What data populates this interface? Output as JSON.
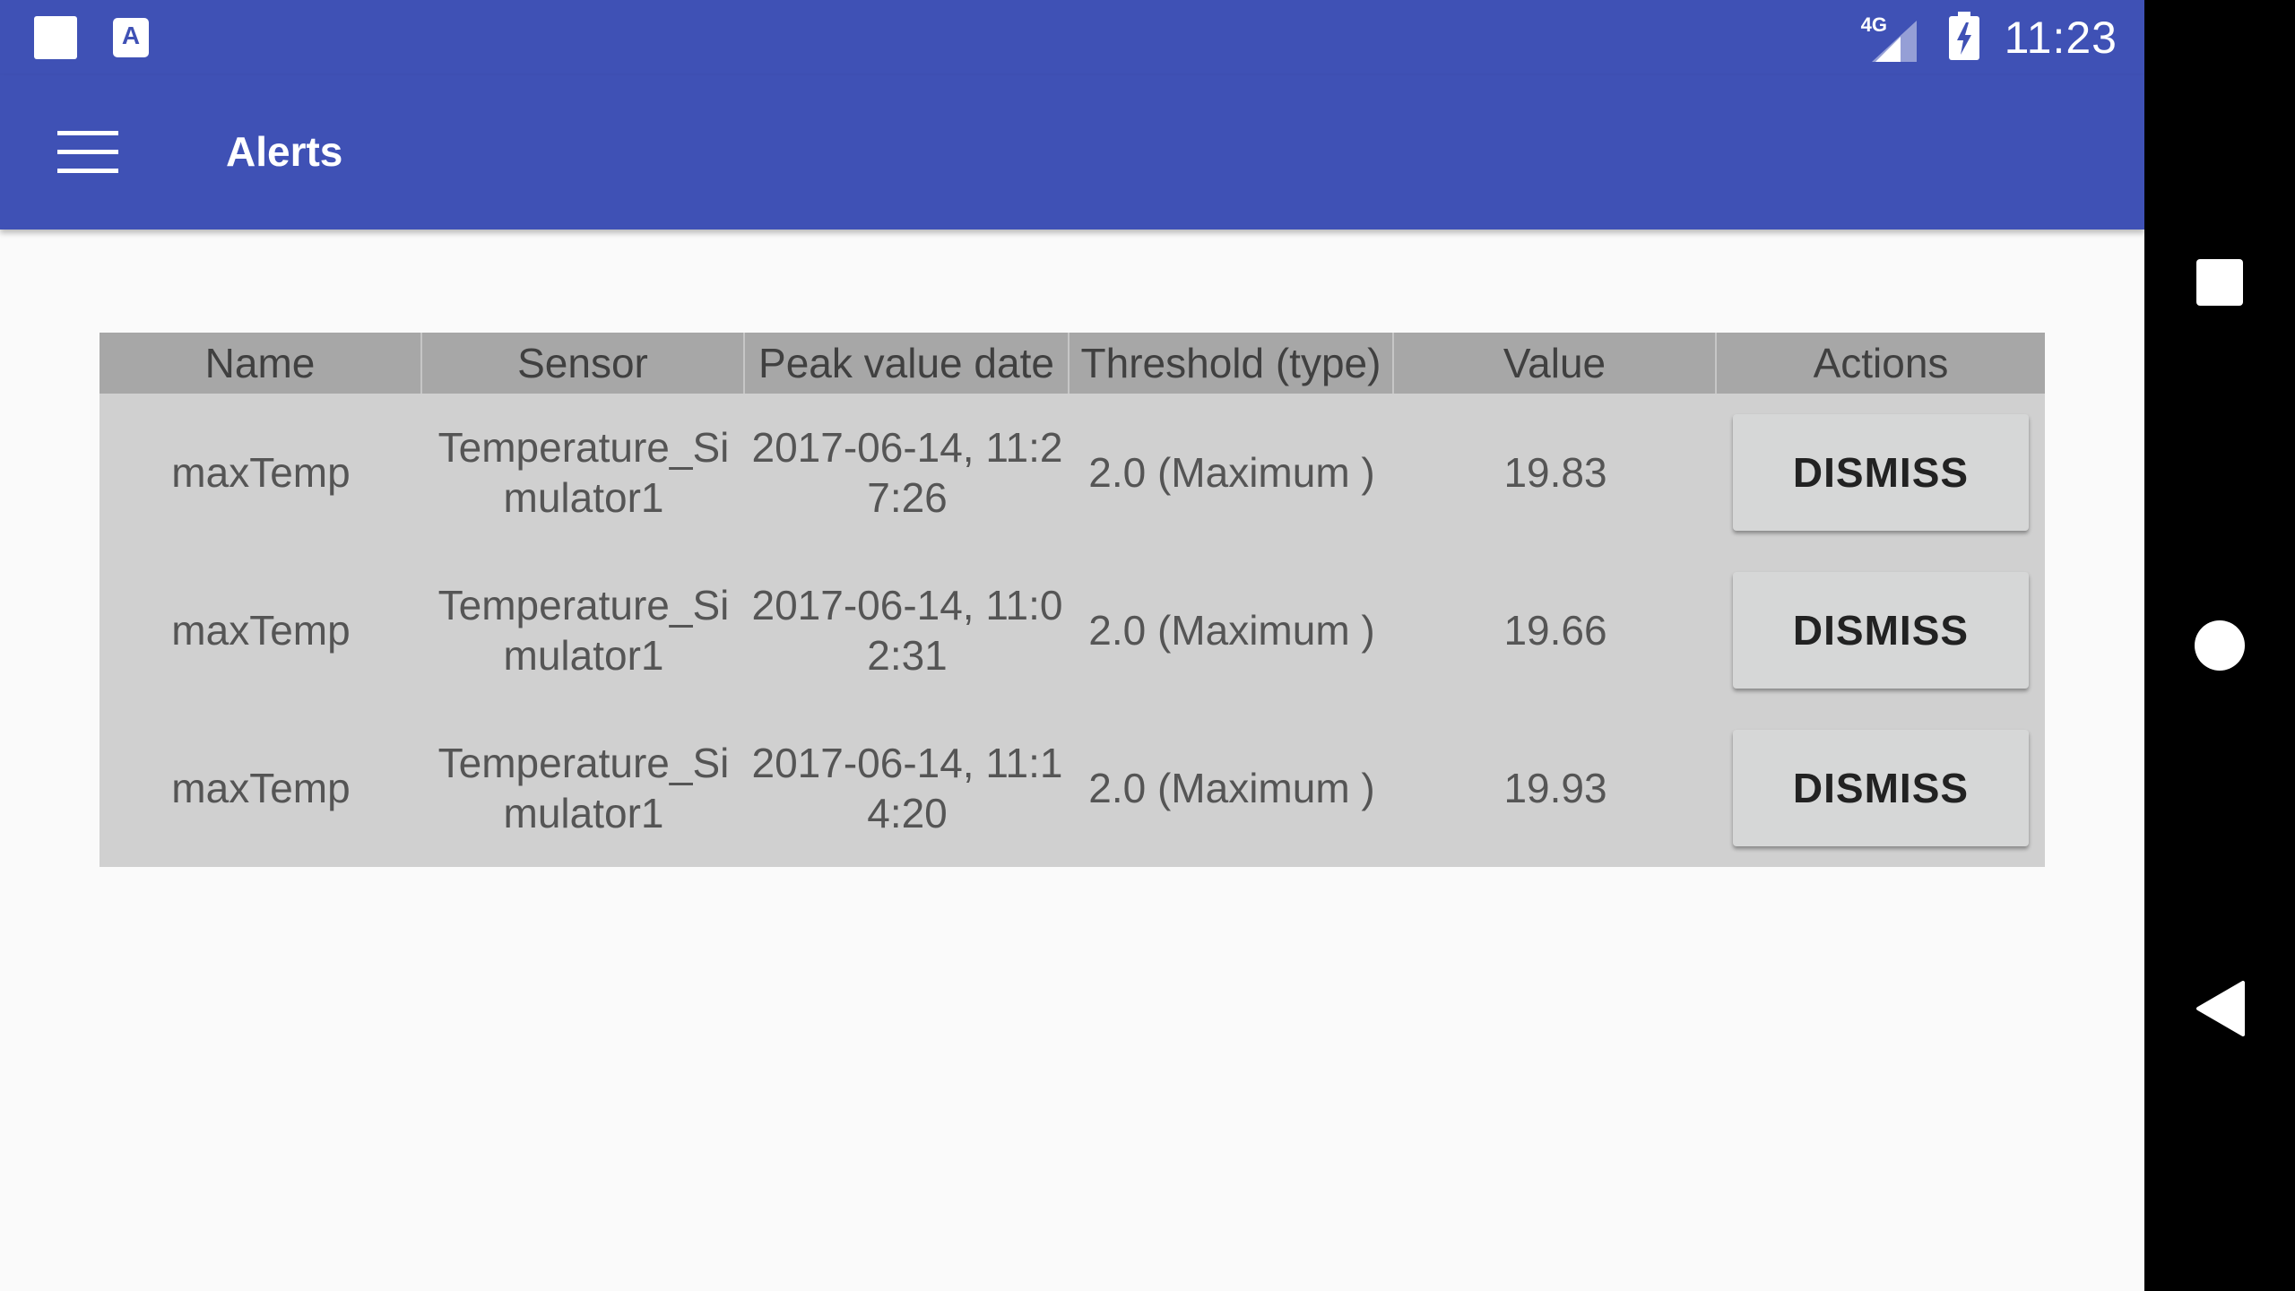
{
  "status_bar": {
    "time": "11:23",
    "network_label": "4G",
    "notification_icons": [
      "square-notification-icon",
      "app-notification-icon"
    ],
    "app_icon_glyph": "A"
  },
  "app_bar": {
    "title": "Alerts",
    "menu_icon": "hamburger-menu-icon",
    "color": "#3f51b5"
  },
  "table": {
    "columns": [
      "Name",
      "Sensor",
      "Peak value date",
      "Threshold (type)",
      "Value",
      "Actions"
    ],
    "rows": [
      {
        "name": "maxTemp",
        "sensor": "Temperature_Simulator1",
        "peak_date": "2017-06-14, 11:27:26",
        "threshold": "2.0 (Maximum )",
        "value": "19.83",
        "action_label": "DISMISS"
      },
      {
        "name": "maxTemp",
        "sensor": "Temperature_Simulator1",
        "peak_date": "2017-06-14, 11:02:31",
        "threshold": "2.0 (Maximum )",
        "value": "19.66",
        "action_label": "DISMISS"
      },
      {
        "name": "maxTemp",
        "sensor": "Temperature_Simulator1",
        "peak_date": "2017-06-14, 11:14:20",
        "threshold": "2.0 (Maximum )",
        "value": "19.93",
        "action_label": "DISMISS"
      }
    ]
  },
  "nav_bar": {
    "buttons": [
      "recents-square-icon",
      "home-circle-icon",
      "back-triangle-icon"
    ]
  }
}
